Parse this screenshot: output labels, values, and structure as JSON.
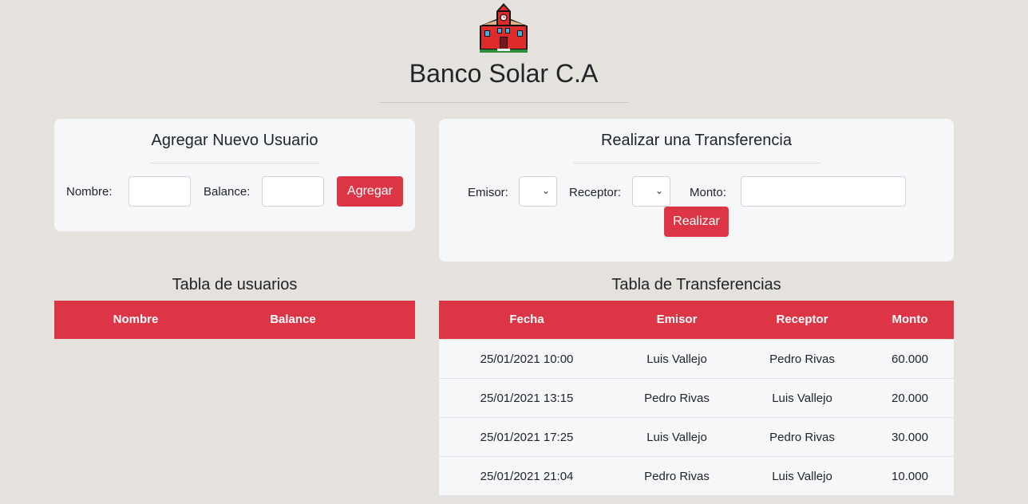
{
  "header": {
    "logo_icon": "school-building-icon",
    "title": "Banco Solar C.A"
  },
  "add_user": {
    "heading": "Agregar Nuevo Usuario",
    "name_label": "Nombre:",
    "name_value": "",
    "balance_label": "Balance:",
    "balance_value": "",
    "submit_label": "Agregar"
  },
  "transfer": {
    "heading": "Realizar una Transferencia",
    "sender_label": "Emisor:",
    "sender_value": "",
    "receiver_label": "Receptor:",
    "receiver_value": "",
    "amount_label": "Monto:",
    "amount_value": "",
    "submit_label": "Realizar"
  },
  "users_table": {
    "title": "Tabla de usuarios",
    "columns": [
      "Nombre",
      "Balance"
    ],
    "rows": []
  },
  "transfers_table": {
    "title": "Tabla de Transferencias",
    "columns": [
      "Fecha",
      "Emisor",
      "Receptor",
      "Monto"
    ],
    "rows": [
      [
        "25/01/2021 10:00",
        "Luis Vallejo",
        "Pedro Rivas",
        "60.000"
      ],
      [
        "25/01/2021 13:15",
        "Pedro Rivas",
        "Luis Vallejo",
        "20.000"
      ],
      [
        "25/01/2021 17:25",
        "Luis Vallejo",
        "Pedro Rivas",
        "30.000"
      ],
      [
        "25/01/2021 21:04",
        "Pedro Rivas",
        "Luis Vallejo",
        "10.000"
      ]
    ]
  },
  "colors": {
    "accent": "#dc3545",
    "background": "#e5e2dd",
    "card": "#f6f7f9"
  }
}
